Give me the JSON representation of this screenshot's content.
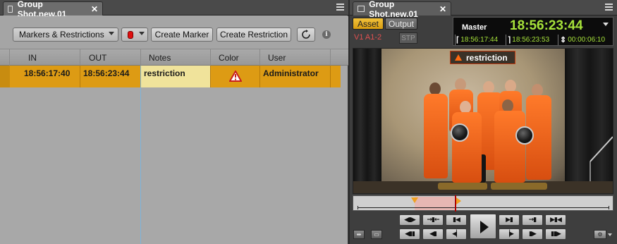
{
  "left_panel": {
    "tab_title": "Group Shot.new.01",
    "toolbar": {
      "filter_dropdown": "Markers & Restrictions",
      "create_marker": "Create Marker",
      "create_restriction": "Create Restriction"
    },
    "columns": [
      "IN",
      "OUT",
      "Notes",
      "Color",
      "User"
    ],
    "rows": [
      {
        "in": "18:56:17:40",
        "out": "18:56:23:44",
        "notes": "restriction",
        "color_icon": "warning-triangle-icon",
        "user": "Administrator"
      }
    ],
    "colors": {
      "row_highlight": "#dd9b14",
      "notes_cell": "#f0e39b",
      "marker_color": "#e01010"
    }
  },
  "right_panel": {
    "tab_title": "Group Shot.new.01",
    "mode_buttons": {
      "asset": "Asset",
      "output": "Output"
    },
    "track_label": "V1 A1-2",
    "stp_label": "STP",
    "timecode": {
      "label": "Master",
      "master": "18:56:23:44",
      "mark_in": "18:56:17:44",
      "mark_out": "18:56:23:53",
      "duration": "00:00:06:10"
    },
    "video_overlay_label": "restriction",
    "colors": {
      "timecode_green": "#a6e23a",
      "restriction_orange": "#ff6a10",
      "asset_active": "#f2c23b"
    }
  }
}
